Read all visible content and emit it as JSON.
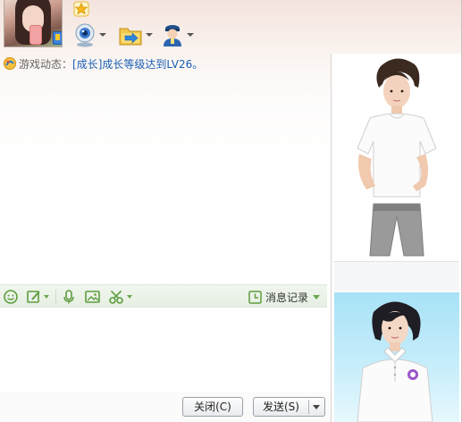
{
  "header": {
    "avatar": "user-avatar-photo",
    "icons": [
      "star-icon",
      "webcam-icon",
      "send-file-icon",
      "remote-assist-icon"
    ]
  },
  "game_news": {
    "label": "游戏动态：",
    "link": "[成长]成长等级达到LV26。"
  },
  "input_toolbar": {
    "icons": [
      "emoji-icon",
      "font-style-icon",
      "voice-icon",
      "image-icon",
      "screenshot-icon"
    ],
    "history_label": "消息记录"
  },
  "buttons": {
    "close_label": "关闭(C)",
    "send_label": "发送(S)"
  },
  "colors": {
    "accent_green": "#6aa84f",
    "link_blue": "#1a5fb4"
  }
}
